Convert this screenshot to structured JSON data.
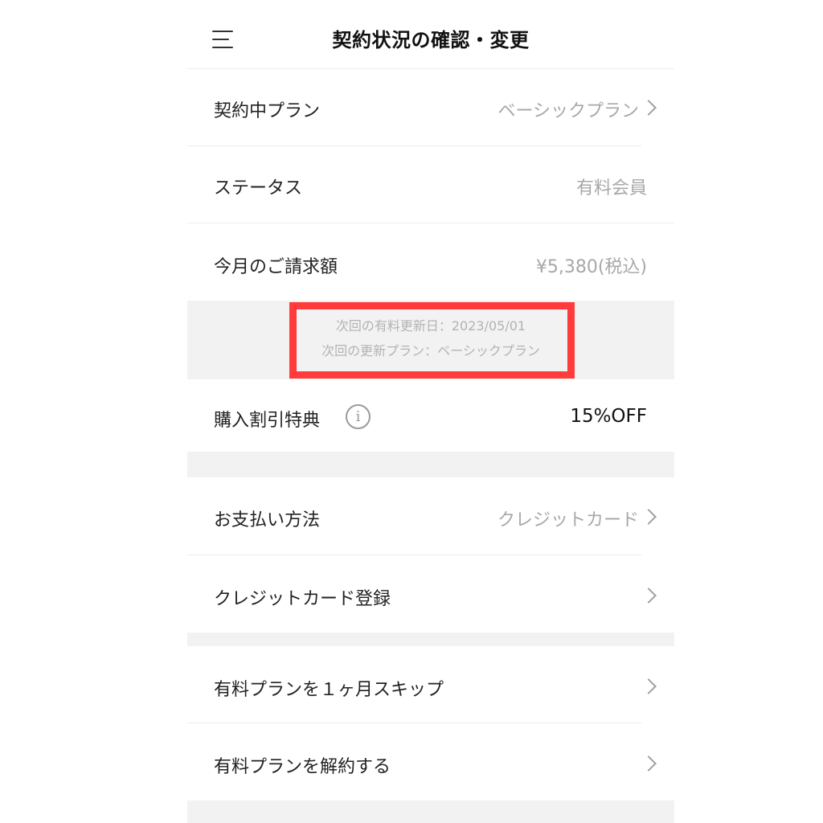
{
  "header": {
    "title": "契約状況の確認・変更",
    "menu_icon": "hamburger-menu-icon"
  },
  "contract": {
    "plan_label": "契約中プラン",
    "plan_value": "ベーシックプラン",
    "status_label": "ステータス",
    "status_value": "有料会員",
    "billing_label": "今月のご請求額",
    "billing_value": "¥5,380(税込)"
  },
  "notice": {
    "renewal_date": "次回の有料更新日：2023/05/01",
    "renewal_plan": "次回の更新プラン：ベーシックプラン",
    "highlight_color": "#ff3b3b"
  },
  "discount": {
    "label": "購入割引特典",
    "info_icon": "i",
    "value": "15%OFF"
  },
  "payment": {
    "method_label": "お支払い方法",
    "method_value": "クレジットカード",
    "card_register_label": "クレジットカード登録"
  },
  "plan_actions": {
    "skip_label": "有料プランを１ヶ月スキップ",
    "cancel_label": "有料プランを解約する"
  }
}
